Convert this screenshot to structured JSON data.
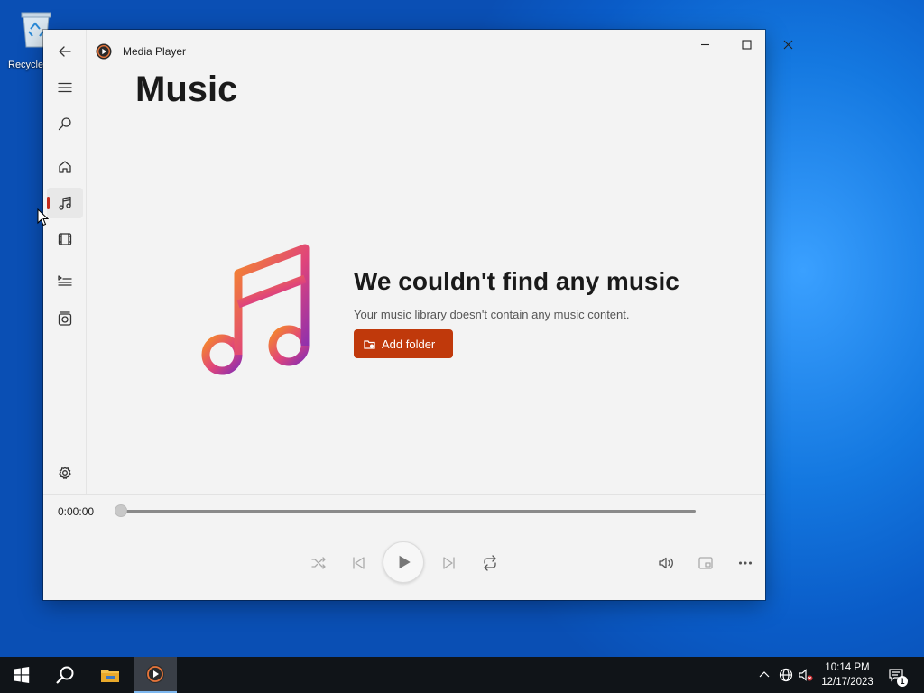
{
  "desktop": {
    "recycle_bin_label": "Recycle"
  },
  "window": {
    "app_title": "Media Player",
    "page_title": "Music",
    "sidebar": {
      "items": [
        {
          "name": "back",
          "icon": "back-arrow-icon"
        },
        {
          "name": "menu",
          "icon": "hamburger-menu-icon"
        },
        {
          "name": "search",
          "icon": "search-icon"
        },
        {
          "name": "home",
          "icon": "home-icon"
        },
        {
          "name": "music",
          "icon": "music-note-icon",
          "active": true
        },
        {
          "name": "video",
          "icon": "film-icon"
        },
        {
          "name": "play-queue",
          "icon": "play-queue-icon"
        },
        {
          "name": "playlists",
          "icon": "playlists-icon"
        },
        {
          "name": "settings",
          "icon": "gear-icon"
        }
      ]
    },
    "empty_state": {
      "heading": "We couldn't find any music",
      "subtitle": "Your music library doesn't contain any music content.",
      "button_label": "Add folder",
      "button_icon": "folder-add-icon",
      "art_icon": "music-note-gradient-icon"
    },
    "player": {
      "current_time": "0:00:00",
      "progress": 0,
      "controls": [
        "shuffle-icon",
        "previous-icon",
        "play-icon",
        "next-icon",
        "repeat-icon",
        "volume-icon",
        "mini-player-icon",
        "more-options-icon"
      ]
    }
  },
  "taskbar": {
    "time": "10:14 PM",
    "date": "12/17/2023",
    "notification_count": "1",
    "apps": [
      "start-icon",
      "search-icon",
      "file-explorer-icon",
      "media-player-icon"
    ]
  },
  "colors": {
    "accent": "#c0390b",
    "active_indicator": "#c42b1c",
    "desktop_blue": "#1478e0",
    "taskbar": "#101418"
  }
}
